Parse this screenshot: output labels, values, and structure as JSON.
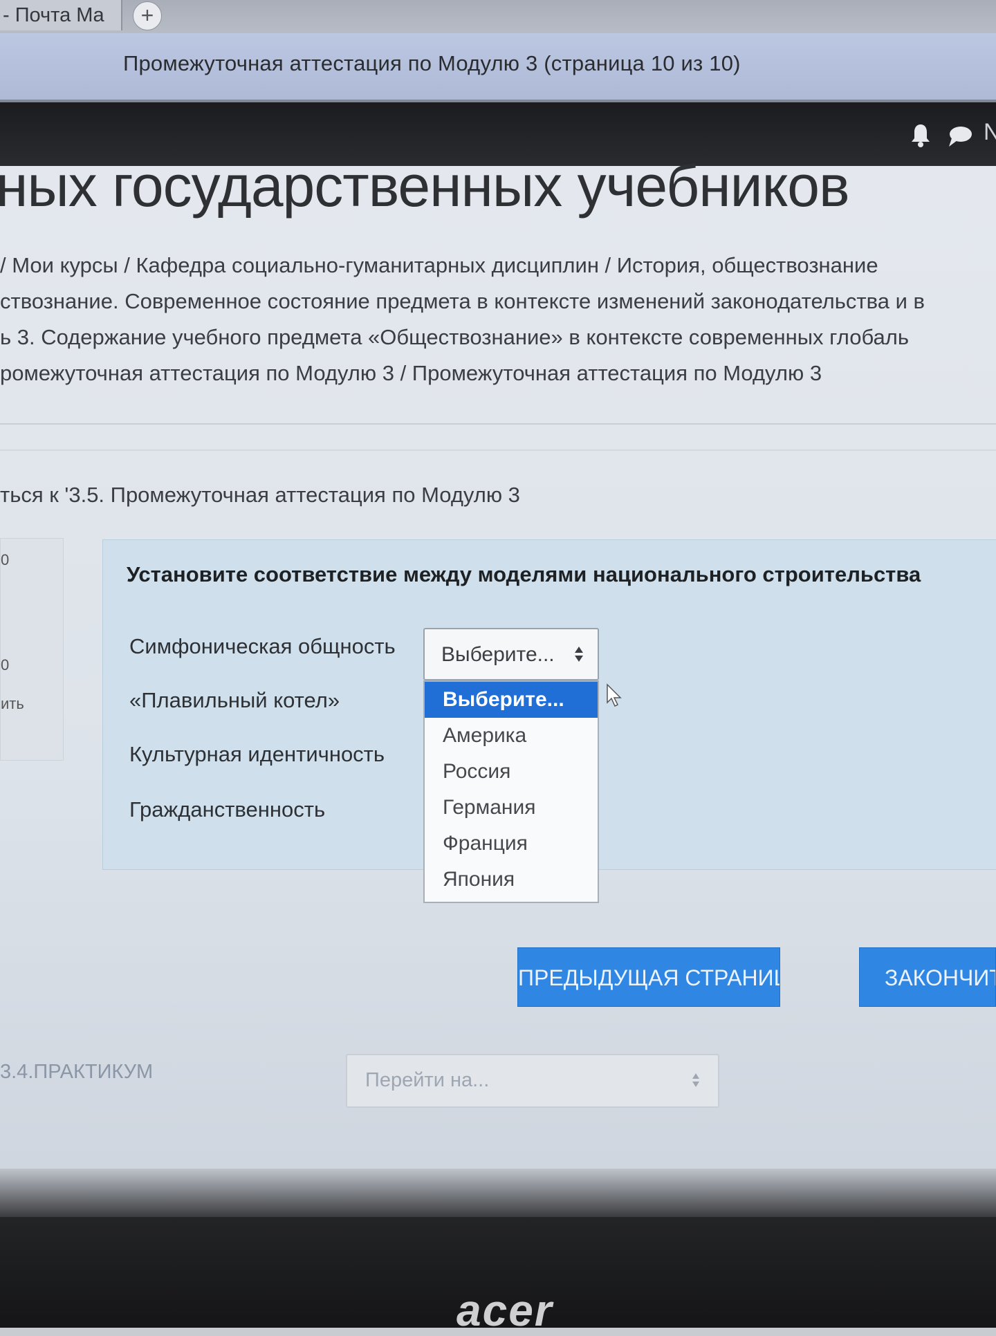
{
  "browser": {
    "tab_title": "- Почта Ma",
    "new_tab_symbol": "+",
    "window_title": "Промежуточная аттестация по Модулю 3 (страница 10 из 10)"
  },
  "topbar": {
    "icons": [
      "bell-icon",
      "chat-icon"
    ],
    "cut_text": "N"
  },
  "course": {
    "title": "ных государственных учебников"
  },
  "breadcrumb": [
    " / Мои курсы  /  Кафедра социально-гуманитарных дисциплин  /  История, обществознание",
    "ствознание. Современное состояние предмета в контексте изменений законодательства и в",
    "ь 3. Содержание учебного предмета «Обществознание» в контексте современных глобаль",
    "ромежуточная аттестация по Модулю 3  /  Промежуточная аттестация по Модулю 3"
  ],
  "return_link": "ться к '3.5. Промежуточная аттестация по Модулю 3",
  "info_box": {
    "cut_top": "0",
    "cut_mid": "0",
    "cut_bottom": "ить"
  },
  "question": {
    "text": "Установите соответствие между моделями национального строительства",
    "items": [
      {
        "label": "Симфоническая общность"
      },
      {
        "label": "«Плавильный котел»"
      },
      {
        "label": "Культурная идентичность"
      },
      {
        "label": "Гражданственность"
      }
    ],
    "select_value": "Выберите...",
    "options": [
      "Выберите...",
      "Америка",
      "Россия",
      "Германия",
      "Франция",
      "Япония"
    ],
    "selected_option": 0
  },
  "navigation": {
    "prev_button": "ПРЕДЫДУЩАЯ СТРАНИЦА",
    "finish_button": "ЗАКОНЧИТ",
    "prev_activity": "3.4.ПРАКТИКУМ",
    "jump_placeholder": "Перейти на..."
  },
  "device": {
    "brand": "acer"
  },
  "colors": {
    "accent": "#2f86e3",
    "selected_option": "#1f6fd6",
    "question_bg": "#cfe0ec",
    "topbar": "#1b1c1f"
  }
}
